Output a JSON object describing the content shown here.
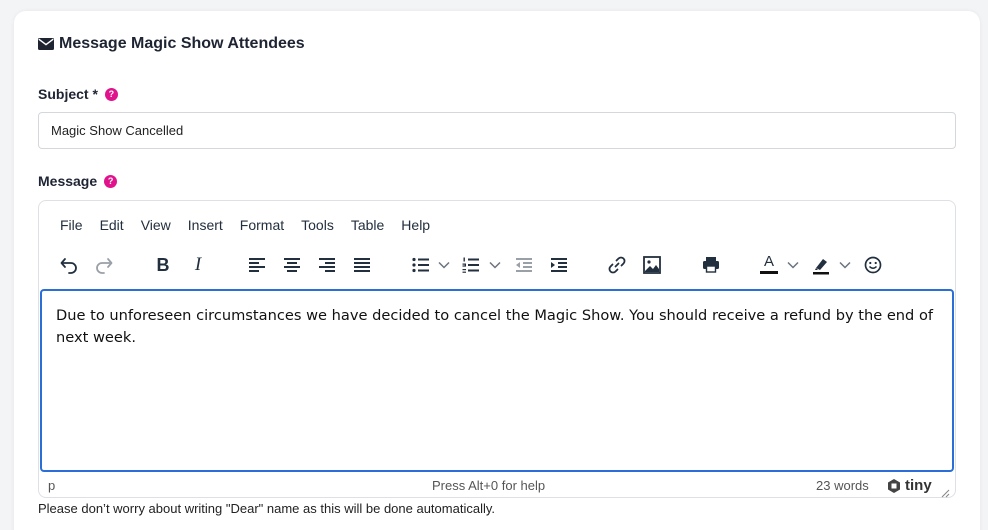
{
  "card": {
    "title": "Message Magic Show Attendees",
    "icon": "envelope-icon"
  },
  "subject": {
    "label": "Subject *",
    "help": "?",
    "value": "Magic Show Cancelled"
  },
  "message": {
    "label": "Message",
    "help": "?"
  },
  "editor": {
    "menu": [
      "File",
      "Edit",
      "View",
      "Insert",
      "Format",
      "Tools",
      "Table",
      "Help"
    ],
    "toolbar_icons": [
      "undo-icon",
      "redo-icon",
      "bold-icon",
      "italic-icon",
      "align-left-icon",
      "align-center-icon",
      "align-right-icon",
      "justify-icon",
      "bullet-list-icon",
      "numbered-list-icon",
      "outdent-icon",
      "indent-icon",
      "link-icon",
      "image-icon",
      "print-icon",
      "text-color-icon",
      "highlight-icon",
      "emoji-icon"
    ],
    "bold_glyph": "B",
    "italic_glyph": "I",
    "text_color_glyph": "A",
    "content": "Due to unforeseen circumstances we have decided to cancel the Magic Show. You should receive a refund by the end of next week.",
    "status": {
      "path": "p",
      "help_text": "Press Alt+0 for help",
      "word_count": "23 words",
      "brand": "tiny"
    }
  },
  "hint": "Please don’t worry about writing \"Dear\" name as this will be done automatically.",
  "colors": {
    "accent_blue": "#2a6ed8",
    "help_pink": "#e0138c",
    "title_dark": "#1f2433"
  }
}
